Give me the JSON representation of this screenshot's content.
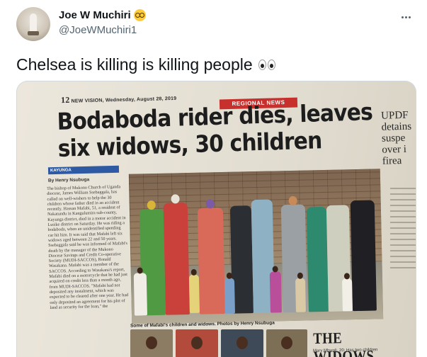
{
  "tweet": {
    "display_name": "Joe W Muchiri",
    "display_name_emoji": "nerd-face-emoji",
    "handle": "@JoeWMuchiri1",
    "more_icon": "more-horizontal-icon",
    "text": "Chelsea is killing is killing people",
    "text_emoji": "eyes-emoji"
  },
  "newspaper": {
    "folio_page": "12",
    "folio_text": "NEW VISION, Wednesday, August 28, 2019",
    "section": "REGIONAL NEWS",
    "headline_line1": "Bodaboda rider dies, leaves",
    "headline_line2": "six widows, 30 children",
    "sidebar_headline": "UPDF detains suspe over i firea",
    "kicker": "KAYUNGA",
    "byline": "By Henry Nsubuga",
    "body": "The bishop of Mukono Church of Uganda diocese, James William Ssebaggala, has called on well-wishers to help the 30 children whose father died in an accident recently. Hassan Mafabi, 51, a resident of Nakatundu in Kangulumira sub-county, Kayunga district, died in a motor accident in Lusike district on Saturday. He was riding a bodaboda, when an unidentified speeding car hit him. It was said that Mafabi left six widows aged between 22 and 50 years. Ssebaggala said he was informed of Mafabi's death by the manager of the Mukono Diocese Savings and Credit Co-operative Society (MUDI-SACCOS), Ronald Wasakana. Mafabi was a member of the SACCOS. According to Wasakana's report, Mafabi died on a motorcycle that he had just acquired on credit less than a month ago, from MUDI-SACCOS. \"Mafabi had not deposited any instalment, which was expected to be cleared after one year. He had only deposited an agreement for his plot of land as security for the loan,\" the",
    "caption": "Some of Mafabi's children and widows. Photos by Henry Nsubuga",
    "widows_heading": "THE WIDOWS",
    "widows_sub": "Mary Mbwali, 20: Has two children"
  },
  "colors": {
    "accent_red": "#c8302d",
    "kicker_blue": "#2d5aa3",
    "text_primary": "#0f1419",
    "text_secondary": "#536471"
  }
}
